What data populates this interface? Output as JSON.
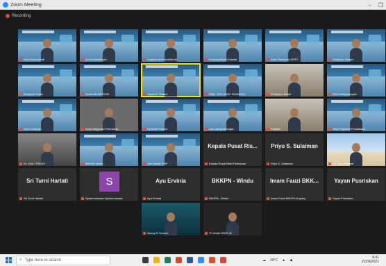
{
  "window": {
    "title": "Zoom Meeting",
    "minimize": "–",
    "maximize": "❐"
  },
  "recording": {
    "label": "Recording"
  },
  "tiles": [
    {
      "name": "Eka Rachmawati",
      "kind": "banner"
    },
    {
      "name": "(Host) Mardhiyah",
      "kind": "banner"
    },
    {
      "name": "Sugiarto (Kemendikbud)",
      "kind": "banner"
    },
    {
      "name": "Endang Aisyah Daniati",
      "kind": "banner"
    },
    {
      "name": "Zaini Permana LHPPI",
      "kind": "banner"
    },
    {
      "name": "Setiawan Tarigan",
      "kind": "banner"
    },
    {
      "name": "Benjamin Kakin",
      "kind": "banner"
    },
    {
      "name": "Khairudin BPPKSB",
      "kind": "banner"
    },
    {
      "name": "Yayuk E. Pratiwi",
      "kind": "active"
    },
    {
      "name": "Rifqi - DIPLOMAT SUMATRA",
      "kind": "banner"
    },
    {
      "name": "M Munira, Bandi",
      "kind": "room"
    },
    {
      "name": "Rini Sulistyaningsih",
      "kind": "banner"
    },
    {
      "name": "Lina Choiriyah",
      "kind": "banner"
    },
    {
      "name": "Andy Bagyanto Priambodo",
      "kind": "photo"
    },
    {
      "name": "Eprianto Pratam",
      "kind": "banner"
    },
    {
      "name": "Lalu pengembangan",
      "kind": "banner"
    },
    {
      "name": "Priyatmi",
      "kind": "room"
    },
    {
      "name": "Tetty Pujiastuti Purwitasari",
      "kind": "banner"
    },
    {
      "name": "Dr. KEB / PSDKP",
      "kind": "grey"
    },
    {
      "name": "BKKPN Jimbo",
      "kind": "banner"
    },
    {
      "name": "Dwi Yuanti, PHP",
      "kind": "banner"
    },
    {
      "name": "Kepala Pusat Riset Perikanan",
      "big": "Kepala Pusat Ris...",
      "kind": "text"
    },
    {
      "name": "Priyo S. Sulaiman",
      "big": "Priyo S. Sulaiman",
      "kind": "text"
    },
    {
      "name": "IG - Bani Setyadi",
      "kind": "beach"
    },
    {
      "name": "Sri Turni Hartati",
      "big": "Sri Turni Hartati",
      "kind": "text"
    },
    {
      "name": "Syahrunnisaan Syahrunnisaan",
      "avatar": "S",
      "kind": "avatar"
    },
    {
      "name": "Ayu Ervinia",
      "big": "Ayu Ervinia",
      "kind": "text"
    },
    {
      "name": "BKKPN - Windu",
      "big": "BKKPN - Windu",
      "kind": "text"
    },
    {
      "name": "Imam Fauzi BKKPN Kupang",
      "big": "Imam Fauzi BKK...",
      "kind": "text"
    },
    {
      "name": "Yayan Pusriskan",
      "big": "Yayan Pusriskan",
      "kind": "text"
    },
    {
      "name": "Nunny R Yunaini",
      "kind": "underwater"
    },
    {
      "name": "Tri Umari WWF-ID",
      "kind": "dark"
    }
  ],
  "taskbar": {
    "search_placeholder": "Type here to search",
    "weather": "29°C",
    "time": "8:41",
    "date": "21/09/2021"
  },
  "colors": {
    "recording": "#e24a2b",
    "active_speaker": "#f5e400",
    "muted": "#e74c3c",
    "avatar_bg": "#8e44ad"
  }
}
